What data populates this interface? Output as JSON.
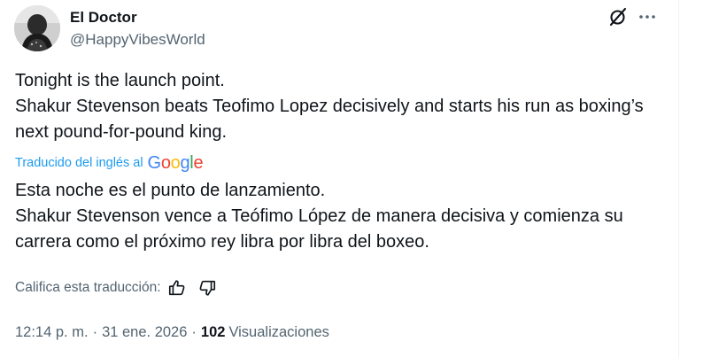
{
  "author": {
    "display_name": "El Doctor",
    "handle": "@HappyVibesWorld",
    "avatar_icon": "profile-photo"
  },
  "header_icons": {
    "grok": "grok-slash-icon",
    "more": "more-dots-icon"
  },
  "original_text": "Tonight is the launch point.\nShakur Stevenson beats Teofimo Lopez decisively and starts his run as boxing’s next pound-for-pound king.",
  "translation": {
    "label": "Traducido del inglés al",
    "provider_letters": [
      {
        "ch": "G",
        "color": "#4285F4"
      },
      {
        "ch": "o",
        "color": "#EA4335"
      },
      {
        "ch": "o",
        "color": "#FBBC05"
      },
      {
        "ch": "g",
        "color": "#4285F4"
      },
      {
        "ch": "l",
        "color": "#34A853"
      },
      {
        "ch": "e",
        "color": "#EA4335"
      }
    ],
    "text": "Esta noche es el punto de lanzamiento.\nShakur Stevenson vence a Teófimo López de manera decisiva y comienza su carrera como el próximo rey libra por libra del boxeo.",
    "rate_label": "Califica esta traducción:",
    "thumbs_up_icon": "thumbs-up-icon",
    "thumbs_down_icon": "thumbs-down-icon"
  },
  "meta": {
    "time": "12:14 p. m.",
    "separator": "·",
    "date": "31 ene. 2026",
    "views_count": "102",
    "views_label": "Visualizaciones"
  },
  "colors": {
    "primary_text": "#0f1419",
    "secondary_text": "#536471",
    "link_blue": "#1d9bf0"
  }
}
